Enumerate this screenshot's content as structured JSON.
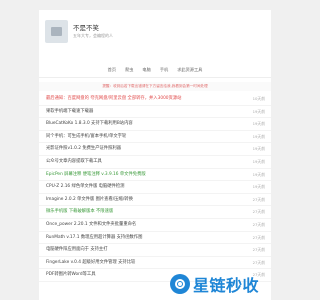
{
  "header": {
    "title": "不是不笑",
    "subtitle": "五年大专，会编程的人"
  },
  "nav": [
    "首页",
    "爬虫",
    "电脑",
    "手机",
    "求此资源工具"
  ],
  "notice": "提醒：收到后若下载出错请在下方留言给我,我看到会第一时间处理",
  "list": [
    {
      "title": "最后通知：百度网盘的 夸克网盘/阿里云盘 全部转存，并入3000资源站",
      "meta": "10天前",
      "style": "red"
    },
    {
      "title": "果软手机端下载速下载器",
      "meta": "19天前",
      "style": ""
    },
    {
      "title": "BlueCatKoKo 1.8.3.0 支持下载利用B站内容",
      "meta": "19天前",
      "style": ""
    },
    {
      "title": "同个手机：可生成手机/富本手机/单文字轮",
      "meta": "19天前",
      "style": ""
    },
    {
      "title": "光影证件照v1.0.2 免费生产证件照利器",
      "meta": "19天前",
      "style": ""
    },
    {
      "title": "公众号文章内容提取下载工具",
      "meta": "19天前",
      "style": ""
    },
    {
      "title": "EpicPen 屏幕注释 便笔注释 v.3.9.16 单文件免费版",
      "meta": "19天前",
      "style": "green"
    },
    {
      "title": "CPU-Z 2.16 绿色单文件版 电脑硬件检测",
      "meta": "19天前",
      "style": ""
    },
    {
      "title": "Imagine 2.0.2 单文件版 图片查看/压缩/转换",
      "meta": "27天前",
      "style": ""
    },
    {
      "title": "微乐手机版 下载破解版本 不限速版",
      "meta": "27天前",
      "style": "green"
    },
    {
      "title": "Once_power 2.20.1 文件和文件夹批量重命名",
      "meta": "27天前",
      "style": ""
    },
    {
      "title": "RunMath v.17.1 数理应用超计算器 支持函数作图",
      "meta": "27天前",
      "style": ""
    },
    {
      "title": "电脑硬件阳应用面向于 支持主打",
      "meta": "27天前",
      "style": ""
    },
    {
      "title": "FingerLake v.0.4 超级好用文件管理 支持比较",
      "meta": "27天前",
      "style": ""
    },
    {
      "title": "PDF转图片转Word等工具",
      "meta": "27天前",
      "style": ""
    }
  ],
  "watermark": "星链秒收"
}
